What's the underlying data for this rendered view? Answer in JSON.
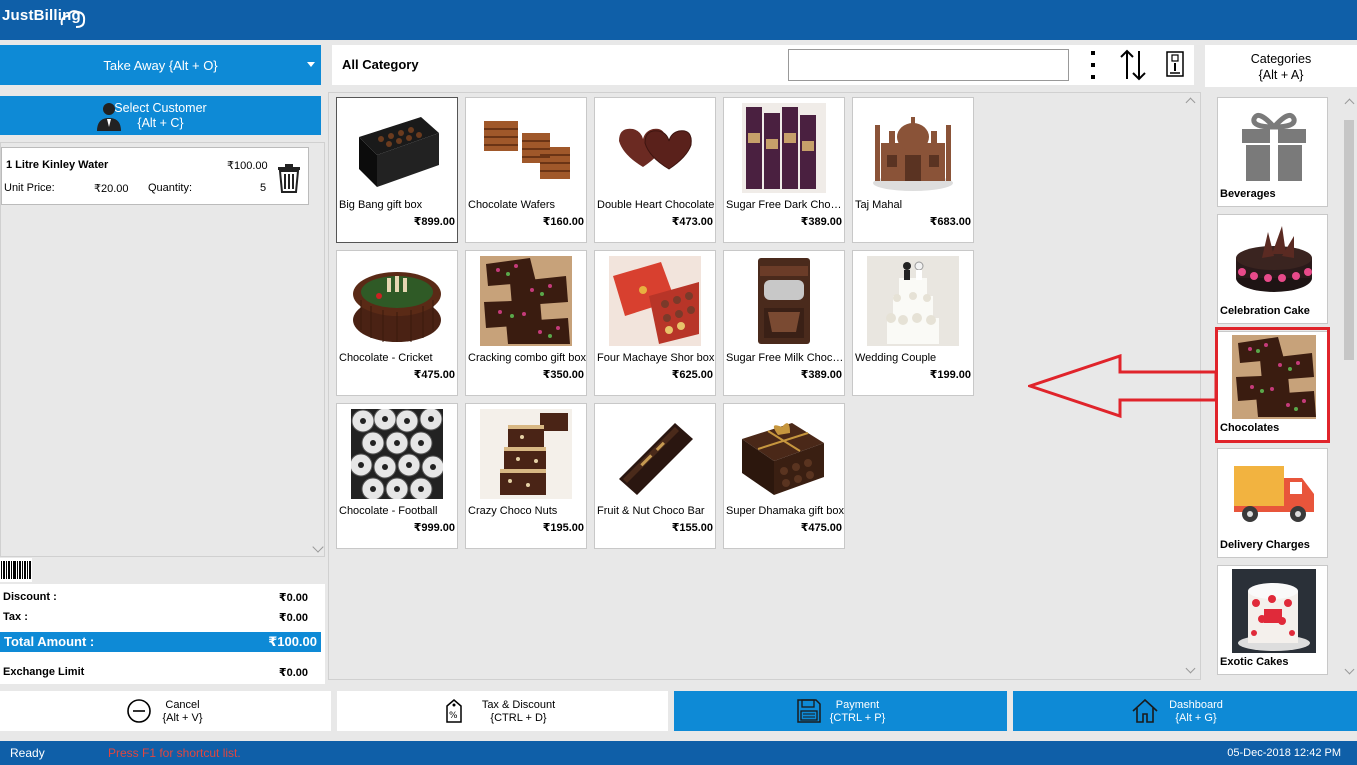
{
  "app": {
    "logo_text": "JustBilling"
  },
  "order_type": {
    "label": "Take Away {Alt + O}"
  },
  "customer": {
    "line1": "Select Customer",
    "line2": "{Alt + C}"
  },
  "cart": {
    "items": [
      {
        "name": "1 Litre Kinley Water",
        "total": "₹100.00",
        "unit_price_label": "Unit Price:",
        "unit_price": "₹20.00",
        "quantity_label": "Quantity:",
        "quantity": "5"
      }
    ]
  },
  "summary": {
    "discount_label": "Discount :",
    "discount": "₹0.00",
    "tax_label": "Tax :",
    "tax": "₹0.00",
    "total_label": "Total Amount :",
    "total": "₹100.00",
    "exchange_label": "Exchange Limit",
    "exchange": "₹0.00"
  },
  "category_bar": {
    "title": "All Category",
    "search_value": ""
  },
  "products": [
    {
      "name": "Big Bang gift box",
      "price": "₹899.00"
    },
    {
      "name": "Chocolate Wafers",
      "price": "₹160.00"
    },
    {
      "name": "Double Heart Chocolate",
      "price": "₹473.00"
    },
    {
      "name": "Sugar Free Dark Chocolate",
      "price": "₹389.00"
    },
    {
      "name": "Taj Mahal",
      "price": "₹683.00"
    },
    {
      "name": "Chocolate - Cricket",
      "price": "₹475.00"
    },
    {
      "name": "Cracking combo gift box",
      "price": "₹350.00"
    },
    {
      "name": "Four Machaye Shor box",
      "price": "₹625.00"
    },
    {
      "name": "Sugar Free Milk Chocolate",
      "price": "₹389.00"
    },
    {
      "name": "Wedding Couple",
      "price": "₹199.00"
    },
    {
      "name": "Chocolate - Football",
      "price": "₹999.00"
    },
    {
      "name": "Crazy Choco Nuts",
      "price": "₹195.00"
    },
    {
      "name": "Fruit & Nut Choco Bar",
      "price": "₹155.00"
    },
    {
      "name": "Super Dhamaka gift box",
      "price": "₹475.00"
    }
  ],
  "categories_header": {
    "line1": "Categories",
    "line2": "{Alt + A}"
  },
  "categories": [
    {
      "name": "Beverages"
    },
    {
      "name": "Celebration Cake"
    },
    {
      "name": "Chocolates"
    },
    {
      "name": "Delivery Charges"
    },
    {
      "name": "Exotic Cakes"
    }
  ],
  "actions": {
    "cancel": {
      "line1": "Cancel",
      "line2": "{Alt + V}"
    },
    "tax_discount": {
      "line1": "Tax & Discount",
      "line2": "{CTRL + D}"
    },
    "payment": {
      "line1": "Payment",
      "line2": "{CTRL + P}"
    },
    "dashboard": {
      "line1": "Dashboard",
      "line2": "{Alt + G}"
    }
  },
  "status": {
    "ready": "Ready",
    "hint": "Press F1 for shortcut list.",
    "datetime": "05-Dec-2018 12:42 PM"
  },
  "colors": {
    "brand": "#0f5fa8",
    "accent": "#0e8ad6",
    "highlight": "#e0242b"
  }
}
